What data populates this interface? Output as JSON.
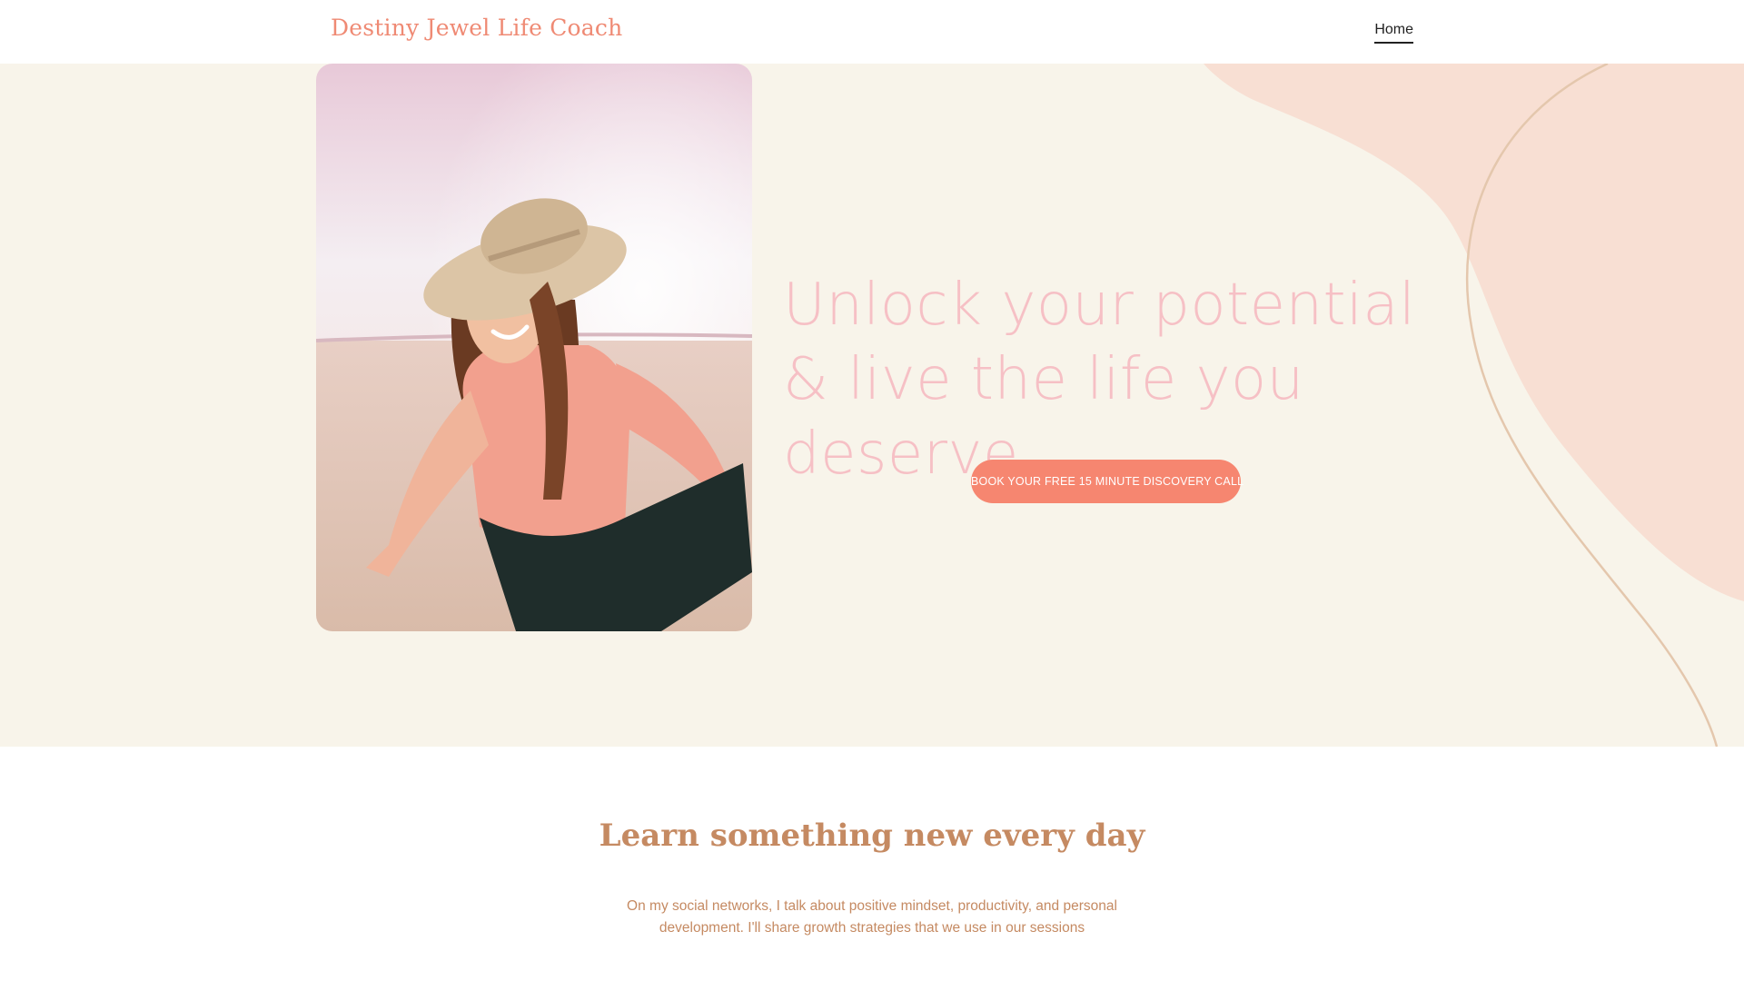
{
  "header": {
    "brand": "Destiny Jewel Life Coach",
    "nav": [
      {
        "label": "Home"
      }
    ]
  },
  "hero": {
    "headline": "Unlock your potential & live the life you deserve",
    "cta_label": "BOOK YOUR FREE 15 MINUTE DISCOVERY CALL",
    "photo_icon": "portrait-photo"
  },
  "learn": {
    "title": "Learn something new every day",
    "body": "On my social networks, I talk about positive mindset, productivity, and personal development. I'll share growth strategies that we use in our sessions"
  },
  "colors": {
    "brand": "#ef8a74",
    "hero_bg": "#f8f4ea",
    "accent_button": "#f68670",
    "headline": "#f6c0c5",
    "section_text": "#c58a62",
    "deco_blob": "#f8dfd3"
  }
}
